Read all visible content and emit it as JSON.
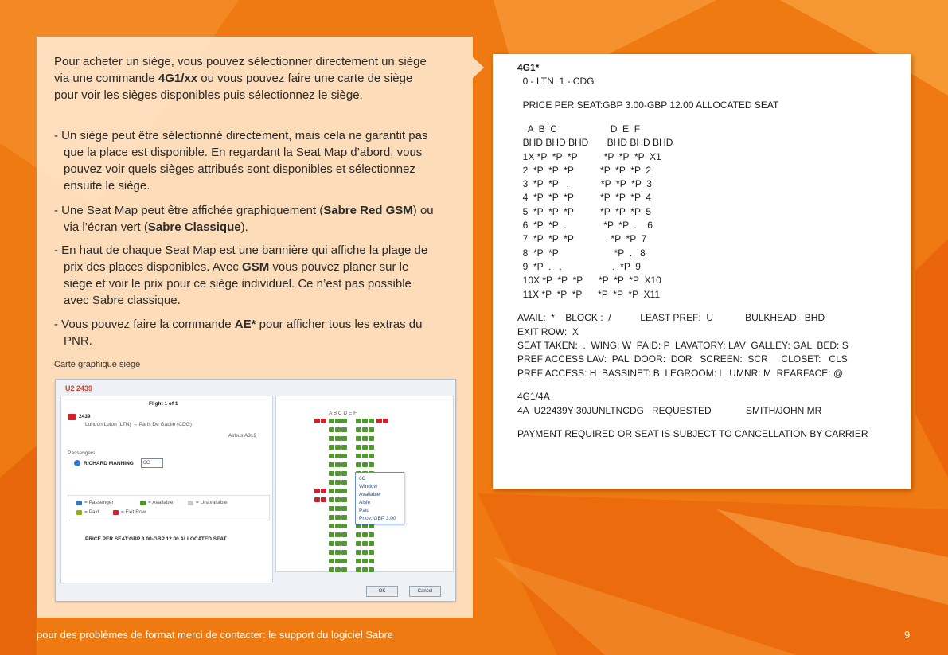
{
  "intro": {
    "pre": "Pour acheter un siège, vous pouvez sélectionner directement un siège via une commande ",
    "bold": "4G1/xx",
    "post": " ou vous pouvez faire une carte de siège pour voir les sièges disponibles puis sélectionnez le siège."
  },
  "bullets": {
    "b1": "- Un siège peut être sélectionné directement, mais cela ne garantit pas que la place est disponible. En regardant la Seat Map d’abord, vous pouvez voir quels sièges attribués sont disponibles et sélectionnez ensuite le siège.",
    "b2_pre": "- Une Seat Map peut être affichée graphiquement (",
    "b2_bold1": "Sabre Red GSM",
    "b2_mid": ") ou via l’écran vert (",
    "b2_bold2": "Sabre Classique",
    "b2_post": ").",
    "b3_pre": "- En haut de chaque Seat Map est une bannière qui affiche la plage de prix des places disponibles. Avec ",
    "b3_bold": "GSM",
    "b3_post": " vous pouvez planer sur le siège et voir le prix pour ce siège individuel. Ce n’est pas possible avec Sabre classique.",
    "b4_pre": "- Vous pouvez faire la commande ",
    "b4_bold": "AE*",
    "b4_post": " pour afficher tous les extras du PNR."
  },
  "caption": "Carte graphique siège",
  "screenshot": {
    "title": "U2 2439",
    "flight_label": "Flight 1 of 1",
    "flight_number": "2439",
    "route": "London Luton (LTN) → Paris De Gaulle (CDG)",
    "aircraft": "Airbus A319",
    "passengers_label": "Passengers",
    "passenger_name": "RICHARD MANNING",
    "seat_value": "6C",
    "legend_passenger": "= Passenger",
    "legend_available": "= Available",
    "legend_unavailable": "= Unavailable",
    "legend_paid": "= Paid",
    "legend_exit": "= Exit Row",
    "price_line": "PRICE PER SEAT:GBP 3.00-GBP 12.00 ALLOCATED SEAT",
    "columns": "A B C    D E F",
    "popup_lines": [
      "6C",
      "Window",
      "Available",
      "Aisle",
      "Paid",
      "Price: GBP 3.00"
    ],
    "ok_label": "OK",
    "cancel_label": "Cancel"
  },
  "terminal": {
    "lines": [
      "4G1*",
      "  0 - LTN  1 - CDG",
      "",
      "  PRICE PER SEAT:GBP 3.00-GBP 12.00 ALLOCATED SEAT",
      "",
      "    A  B  C                    D  E  F",
      "  BHD BHD BHD       BHD BHD BHD",
      "  1X *P  *P  *P          *P  *P  *P  X1",
      "  2  *P  *P  *P          *P  *P  *P  2",
      "  3  *P  *P   .            *P  *P  *P  3",
      "  4  *P  *P  *P          *P  *P  *P  4",
      "  5  *P  *P  *P          *P  *P  *P  5",
      "  6  *P  *P  .              *P  *P  .    6",
      "  7  *P  *P  *P            . *P  *P  7",
      "  8  *P  *P                     *P  .   8",
      "  9  *P  .   .                   .  *P  9",
      "  10X *P  *P  *P      *P  *P  *P  X10",
      "  11X *P  *P  *P      *P  *P  *P  X11",
      "",
      "AVAIL:  *    BLOCK :  /           LEAST PREF:  U            BULKHEAD:  BHD",
      "EXIT ROW:  X",
      "SEAT TAKEN:  .  WING: W  PAID: P  LAVATORY: LAV  GALLEY: GAL  BED: S",
      "PREF ACCESS LAV:  PAL  DOOR:  DOR   SCREEN:  SCR     CLOSET:   CLS",
      "PREF ACCESS: H  BASSINET: B  LEGROOM: L  UMNR: M  REARFACE: @",
      "",
      "4G1/4A",
      "4A  U22439Y 30JUNLTNCDG   REQUESTED             SMITH/JOHN MR",
      "",
      "PAYMENT REQUIRED OR SEAT IS SUBJECT TO CANCELLATION BY CARRIER"
    ]
  },
  "footer": "pour des problèmes de format merci de contacter: le support du logiciel Sabre",
  "page_number": "9",
  "colors": {
    "background": "#f07a12",
    "card": "#ffecd6",
    "seat_available": "#4e9a2a",
    "exit_row": "#d4202a"
  }
}
